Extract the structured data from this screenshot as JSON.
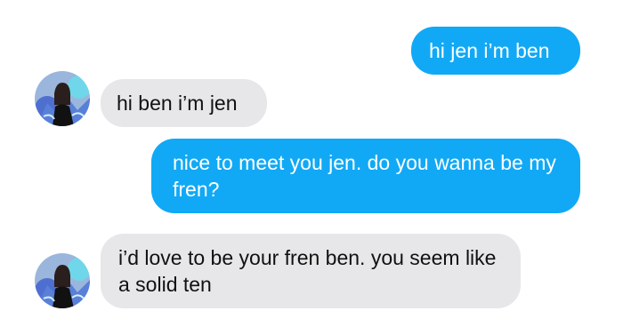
{
  "conversation": {
    "messages": [
      {
        "sender": "me",
        "text": "hi jen i’m ben"
      },
      {
        "sender": "jen",
        "text": "hi ben i’m jen"
      },
      {
        "sender": "me",
        "text": "nice to meet you jen. do you wanna be my fren?"
      },
      {
        "sender": "jen",
        "text": "i’d love to be your fren ben. you seem like a solid ten"
      }
    ]
  },
  "colors": {
    "sent_bubble": "#11a9f5",
    "received_bubble": "#e7e7e9",
    "background": "#ffffff"
  },
  "icons": {
    "contact_avatar": "profile-photo-icon"
  }
}
